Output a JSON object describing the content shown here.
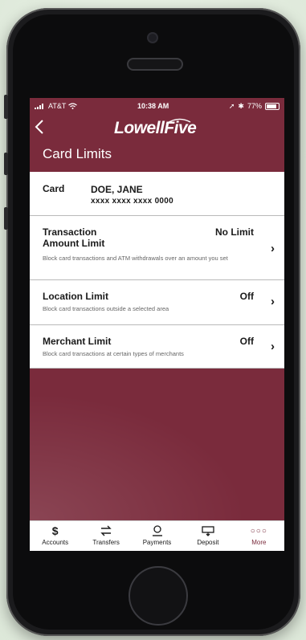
{
  "status": {
    "carrier": "AT&T",
    "time": "10:38 AM",
    "battery": "77%"
  },
  "header": {
    "back_label": "<",
    "logo": "LowellFive",
    "page_title": "Card Limits"
  },
  "card": {
    "label": "Card",
    "holder": "DOE, JANE",
    "number": "xxxx xxxx xxxx 0000"
  },
  "limits": [
    {
      "title_line1": "Transaction",
      "title_line2": "Amount Limit",
      "value": "No Limit",
      "description": "Block card transactions and ATM withdrawals over an amount you set"
    },
    {
      "title_line1": "Location Limit",
      "value": "Off",
      "description": "Block card transactions outside a selected area"
    },
    {
      "title_line1": "Merchant Limit",
      "value": "Off",
      "description": "Block card transactions at certain types of merchants"
    }
  ],
  "tabs": [
    {
      "label": "Accounts",
      "icon": "dollar-icon"
    },
    {
      "label": "Transfers",
      "icon": "transfer-icon"
    },
    {
      "label": "Payments",
      "icon": "payments-icon"
    },
    {
      "label": "Deposit",
      "icon": "deposit-icon"
    },
    {
      "label": "More",
      "icon": "more-icon"
    }
  ],
  "colors": {
    "brand": "#7a2b3c",
    "background": "#e9f1e6"
  }
}
